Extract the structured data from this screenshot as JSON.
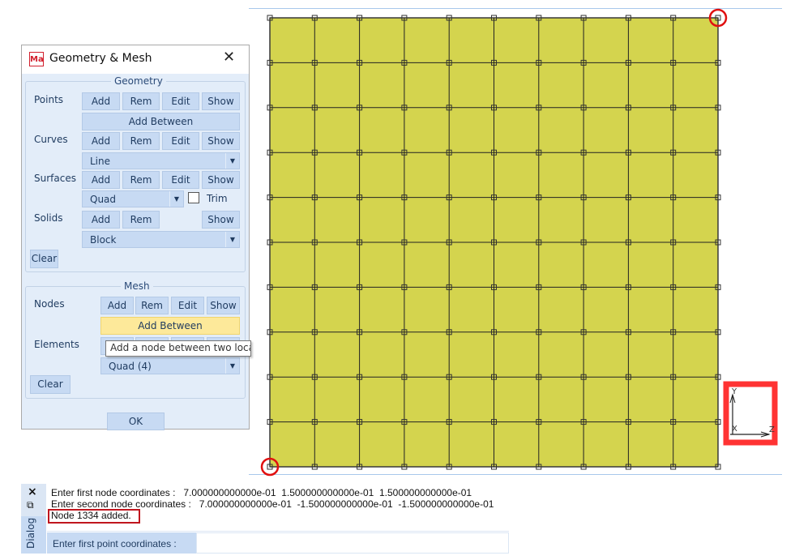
{
  "window": {
    "title": "Geometry & Mesh",
    "logo": "Ma",
    "close_icon": "close-icon"
  },
  "geometry": {
    "title": "Geometry",
    "points": {
      "label": "Points",
      "add": "Add",
      "rem": "Rem",
      "edit": "Edit",
      "show": "Show",
      "add_between": "Add Between"
    },
    "curves": {
      "label": "Curves",
      "add": "Add",
      "rem": "Rem",
      "edit": "Edit",
      "show": "Show",
      "type": "Line"
    },
    "surfaces": {
      "label": "Surfaces",
      "add": "Add",
      "rem": "Rem",
      "edit": "Edit",
      "show": "Show",
      "type": "Quad",
      "trim_label": "Trim",
      "trim_checked": false
    },
    "solids": {
      "label": "Solids",
      "add": "Add",
      "rem": "Rem",
      "show": "Show",
      "type": "Block"
    },
    "clear": "Clear"
  },
  "mesh": {
    "title": "Mesh",
    "nodes": {
      "label": "Nodes",
      "add": "Add",
      "rem": "Rem",
      "edit": "Edit",
      "show": "Show",
      "add_between": "Add Between"
    },
    "elements": {
      "label": "Elements",
      "type": "Quad (4)"
    },
    "clear": "Clear",
    "tooltip": "Add a node between two locations"
  },
  "ok": "OK",
  "viewport": {
    "rows": 10,
    "cols": 10,
    "fill_color": "#d4d44e",
    "line_color": "#222222",
    "axes": {
      "y": "Y",
      "x": "X",
      "z": "Z"
    },
    "highlight_color": "#ff3333"
  },
  "console": {
    "close": "×",
    "restore": "⧉",
    "tab": "Dialog",
    "lines": [
      "Enter first node coordinates :   7.000000000000e-01  1.500000000000e-01  1.500000000000e-01",
      "Enter second node coordinates :   7.000000000000e-01  -1.500000000000e-01  -1.500000000000e-01",
      "Node 1334 added."
    ],
    "prompt": "Enter first point coordinates :",
    "input_value": ""
  }
}
